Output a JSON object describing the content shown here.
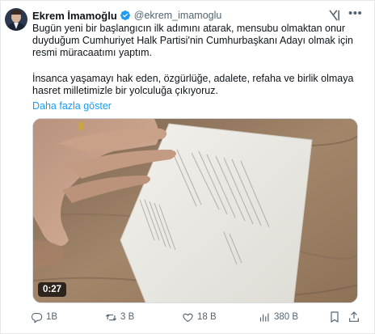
{
  "tweet": {
    "author_name": "Ekrem İmamoğlu",
    "author_handle": "@ekrem_imamoglu",
    "verified": true,
    "text_lines": [
      "Bugün yeni bir başlangıcın ilk adımını atarak, mensubu olmaktan onur",
      "duyduğum Cumhuriyet Halk Partisi'nin Cumhurbaşkanı Adayı olmak için",
      "resmi müracaatımı yaptım.",
      "",
      "İnsanca yaşamayı hak eden, özgürlüğe, adalete, refaha ve birlik olmaya",
      "hasret milletimizle bir yolculuğa çıkıyoruz."
    ],
    "show_more_label": "Daha fazla göster",
    "media": {
      "type": "video",
      "duration": "0:27"
    },
    "metrics": {
      "replies": "1B",
      "reposts": "3 B",
      "likes": "18 B",
      "views": "380 B"
    }
  },
  "icons": {
    "verified": "verified-badge-icon",
    "grok": "grok-icon",
    "more": "more-icon",
    "reply": "reply-icon",
    "repost": "repost-icon",
    "like": "heart-icon",
    "views": "views-icon",
    "bookmark": "bookmark-icon",
    "share": "share-icon"
  },
  "colors": {
    "text": "#0f1419",
    "secondary": "#536471",
    "link": "#1d9bf0",
    "verified": "#1d9bf0"
  }
}
